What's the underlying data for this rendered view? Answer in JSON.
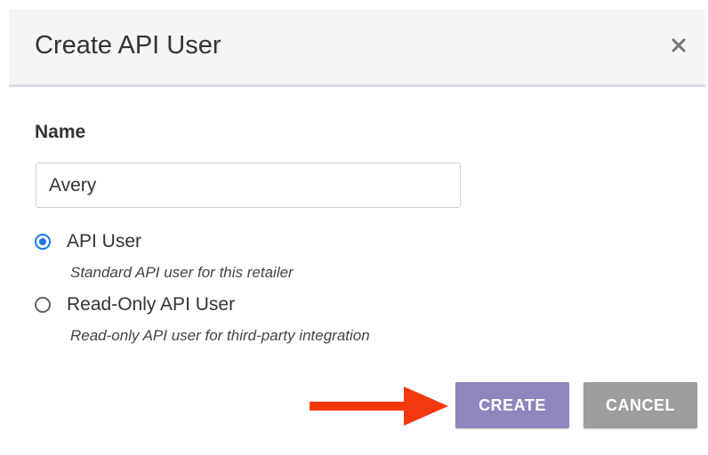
{
  "dialog": {
    "title": "Create API User",
    "close_icon": "close-x-icon"
  },
  "form": {
    "name_label": "Name",
    "name_value": "Avery",
    "options": [
      {
        "label": "API User",
        "description": "Standard API user for this retailer",
        "checked": true
      },
      {
        "label": "Read-Only API User",
        "description": "Read-only API user for third-party integration",
        "checked": false
      }
    ]
  },
  "buttons": {
    "create_label": "CREATE",
    "cancel_label": "CANCEL"
  },
  "annotation": {
    "arrow_icon": "arrow-right-icon",
    "arrow_color": "#f2380c"
  },
  "colors": {
    "create_button": "#8f86bd",
    "cancel_button": "#9e9e9e",
    "radio_selected": "#1a73e8",
    "header_bg": "#f5f5f6"
  }
}
